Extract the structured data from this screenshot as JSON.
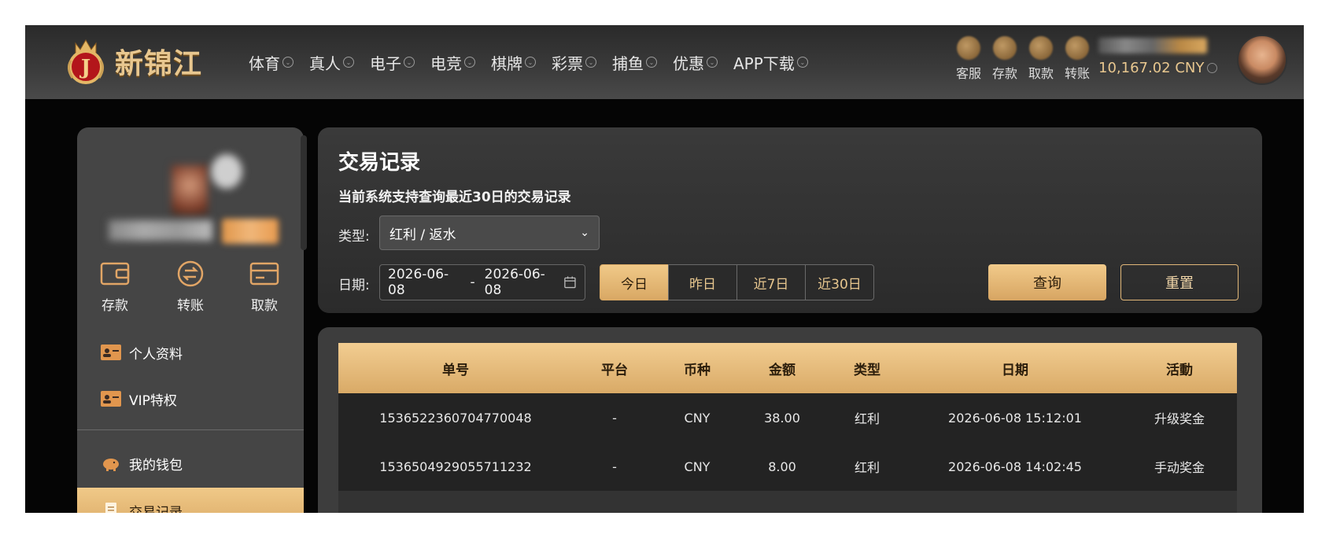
{
  "brand": {
    "name": "新锦江",
    "accent": "#e8c78f"
  },
  "nav": [
    {
      "label": "体育"
    },
    {
      "label": "真人"
    },
    {
      "label": "电子"
    },
    {
      "label": "电竞"
    },
    {
      "label": "棋牌"
    },
    {
      "label": "彩票"
    },
    {
      "label": "捕鱼"
    },
    {
      "label": "优惠"
    },
    {
      "label": "APP下载"
    }
  ],
  "quick": [
    {
      "label": "客服",
      "icon": "headset-icon"
    },
    {
      "label": "存款",
      "icon": "deposit-icon"
    },
    {
      "label": "取款",
      "icon": "withdraw-icon"
    },
    {
      "label": "转账",
      "icon": "transfer-icon"
    }
  ],
  "account": {
    "balance": "10,167.02 CNY"
  },
  "sidebar": {
    "wallet_actions": [
      {
        "label": "存款",
        "icon": "wallet-icon"
      },
      {
        "label": "转账",
        "icon": "transfer-circle-icon"
      },
      {
        "label": "取款",
        "icon": "card-icon"
      }
    ],
    "menu": [
      {
        "label": "个人资料",
        "icon": "id-card-icon"
      },
      {
        "label": "VIP特权",
        "icon": "id-card-icon"
      },
      {
        "label": "我的钱包",
        "icon": "piggy-bank-icon"
      },
      {
        "label": "交易记录",
        "icon": "document-icon"
      }
    ]
  },
  "query": {
    "title": "交易记录",
    "subtitle": "当前系统支持查询最近30日的交易记录",
    "type_label": "类型:",
    "type_value": "红利 / 返水",
    "date_label": "日期:",
    "date_from": "2026-06-08",
    "date_sep": "-",
    "date_to": "2026-06-08",
    "ranges": [
      {
        "label": "今日"
      },
      {
        "label": "昨日"
      },
      {
        "label": "近7日"
      },
      {
        "label": "近30日"
      }
    ],
    "search_label": "查询",
    "reset_label": "重置"
  },
  "table": {
    "columns": [
      "单号",
      "平台",
      "币种",
      "金额",
      "类型",
      "日期",
      "活動"
    ],
    "rows": [
      [
        "1536522360704770048",
        "-",
        "CNY",
        "38.00",
        "红利",
        "2026-06-08 15:12:01",
        "升级奖金"
      ],
      [
        "1536504929055711232",
        "-",
        "CNY",
        "8.00",
        "红利",
        "2026-06-08 14:02:45",
        "手动奖金"
      ]
    ]
  }
}
